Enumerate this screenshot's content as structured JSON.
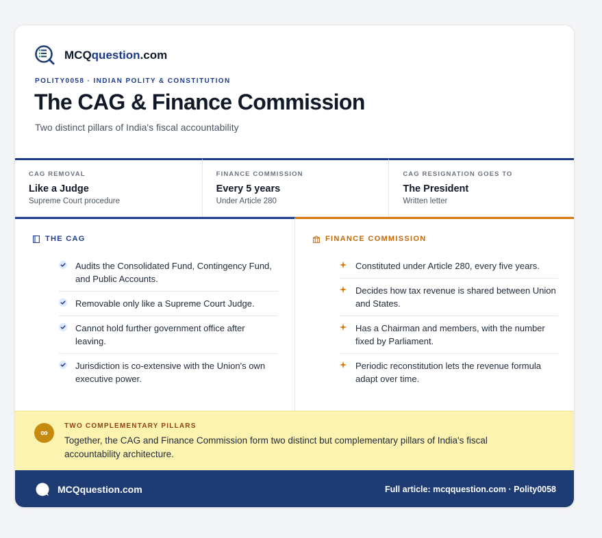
{
  "brand": {
    "name_prefix": "MCQ",
    "name_highlight": "question",
    "name_suffix": ".com",
    "icon": "quiz-checklist-magnifier-icon"
  },
  "header": {
    "kicker": "POLITY0058 · INDIAN POLITY & CONSTITUTION",
    "title": "The CAG & Finance Commission",
    "subtitle": "Two distinct pillars of India's fiscal accountability"
  },
  "stats": [
    {
      "label": "CAG REMOVAL",
      "value": "Like a Judge",
      "sub": "Supreme Court procedure"
    },
    {
      "label": "FINANCE COMMISSION",
      "value": "Every 5 years",
      "sub": "Under Article 280"
    },
    {
      "label": "CAG RESIGNATION GOES TO",
      "value": "The President",
      "sub": "Written letter"
    }
  ],
  "cag": {
    "heading": "THE CAG",
    "icon": "book-icon",
    "bullet_icon": "check-badge-icon",
    "items": [
      "Audits the Consolidated Fund, Contingency Fund, and Public Accounts.",
      "Removable only like a Supreme Court Judge.",
      "Cannot hold further government office after leaving.",
      "Jurisdiction is co-extensive with the Union's own executive power."
    ]
  },
  "finance_commission": {
    "heading": "FINANCE COMMISSION",
    "icon": "bank-icon",
    "bullet_icon": "sparkle-icon",
    "items": [
      "Constituted under Article 280, every five years.",
      "Decides how tax revenue is shared between Union and States.",
      "Has a Chairman and members, with the number fixed by Parliament.",
      "Periodic reconstitution lets the revenue formula adapt over time."
    ]
  },
  "callout": {
    "icon_glyph": "∞",
    "label": "TWO COMPLEMENTARY PILLARS",
    "text": "Together, the CAG and Finance Commission form two distinct but complementary pillars of India's fiscal accountability architecture."
  },
  "footer": {
    "name": "MCQquestion.com",
    "link": "Full article: mcqquestion.com · Polity0058"
  },
  "colors": {
    "navy": "#1e3a8a",
    "amber": "#d97706",
    "callout_bg": "#fdf3b0",
    "footer_bg": "#1f3b74"
  }
}
